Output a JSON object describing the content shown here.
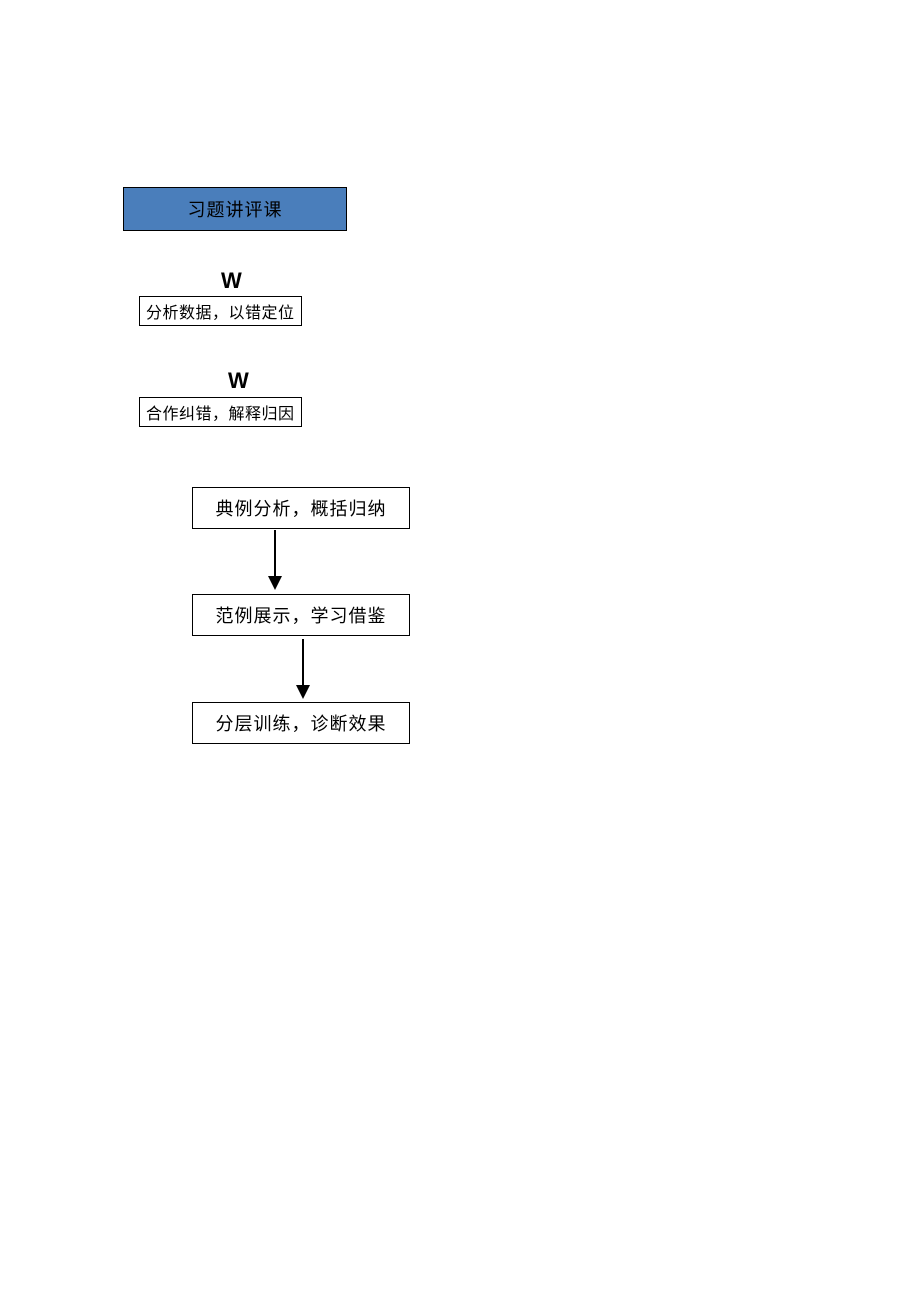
{
  "header": "习题讲评课",
  "w_markers": {
    "w1": "W",
    "w2": "W"
  },
  "steps": {
    "s1": "分析数据，以错定位",
    "s2": "合作纠错，解释归因",
    "s3": "典例分析，概括归纳",
    "s4": "范例展示，学习借鉴",
    "s5": "分层训练，诊断效果"
  }
}
